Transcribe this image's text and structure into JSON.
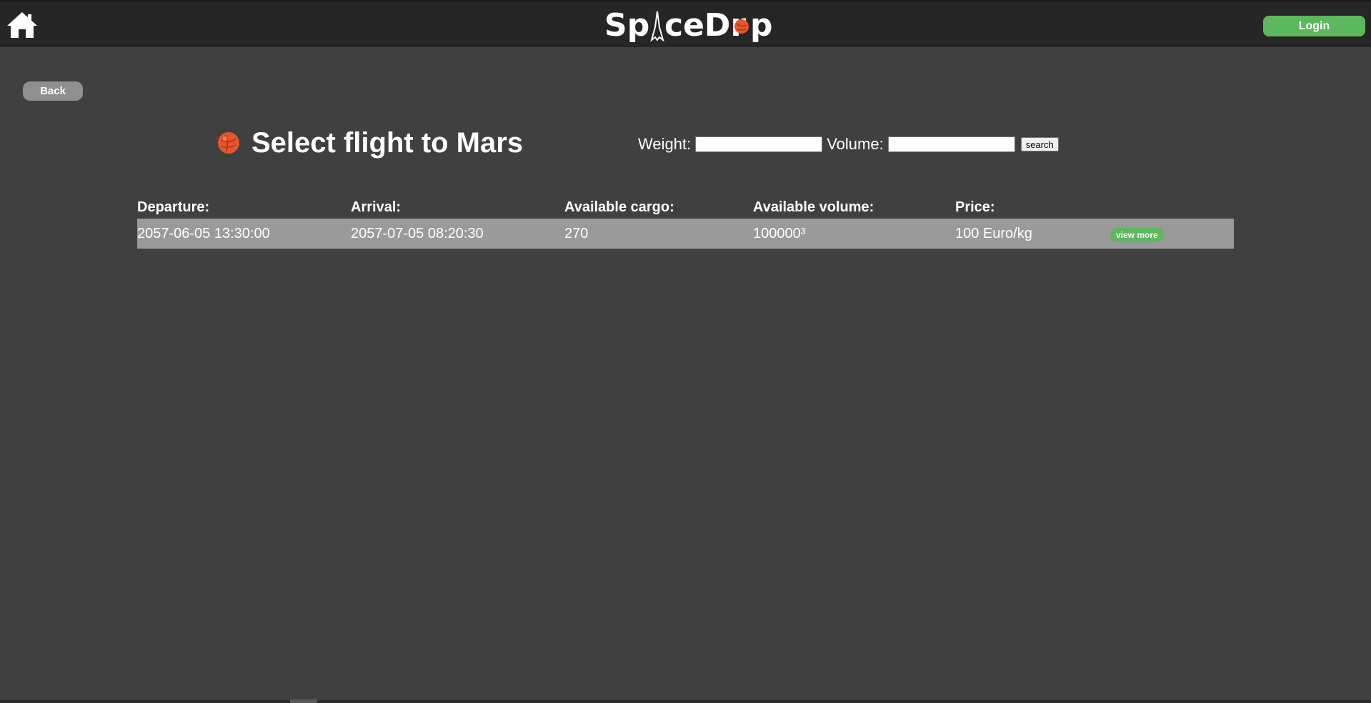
{
  "header": {
    "logo_text": "SpaceDrop",
    "login_label": "Login",
    "home_icon": "home-icon"
  },
  "nav": {
    "back_label": "Back"
  },
  "page": {
    "title": "Select flight to Mars",
    "planet_icon": "mars-icon"
  },
  "filters": {
    "weight_label": "Weight:",
    "weight_value": "",
    "volume_label": "Volume:",
    "volume_value": "",
    "search_label": "search"
  },
  "table": {
    "headers": [
      "Departure:",
      "Arrival:",
      "Available cargo:",
      "Available volume:",
      "Price:"
    ],
    "rows": [
      {
        "departure": "2057-06-05 13:30:00",
        "arrival": "2057-07-05 08:20:30",
        "cargo": "270",
        "volume": "100000³",
        "price": "100 Euro/kg",
        "action_label": "view more"
      }
    ]
  },
  "colors": {
    "background": "#404040",
    "topbar": "#262626",
    "accent_green": "#5cb85c",
    "row_bg": "#9a9a9a",
    "mars": "#e4572e"
  }
}
